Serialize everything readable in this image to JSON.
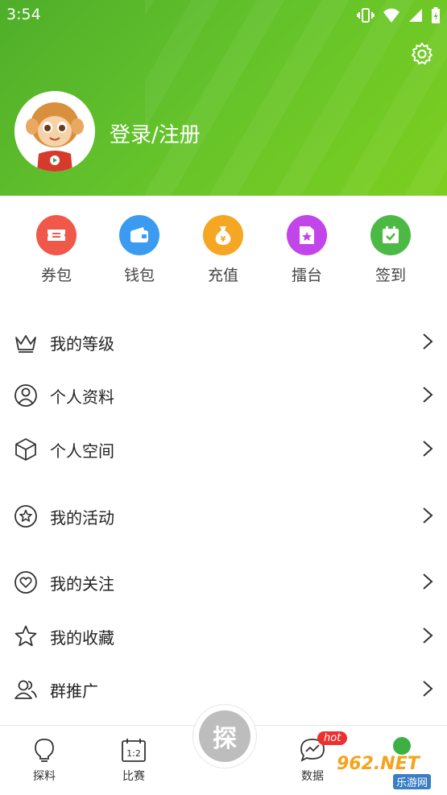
{
  "status": {
    "time": "3:54"
  },
  "profile": {
    "login_label": "登录/注册"
  },
  "quick_actions": [
    {
      "label": "券包",
      "color": "#f0584a",
      "icon": "ticket-icon"
    },
    {
      "label": "钱包",
      "color": "#3a9bf0",
      "icon": "wallet-icon"
    },
    {
      "label": "充值",
      "color": "#f5a623",
      "icon": "money-bag-icon"
    },
    {
      "label": "擂台",
      "color": "#c145e8",
      "icon": "card-star-icon"
    },
    {
      "label": "签到",
      "color": "#4cb944",
      "icon": "calendar-check-icon"
    }
  ],
  "menu": [
    {
      "label": "我的等级",
      "icon": "crown-icon"
    },
    {
      "label": "个人资料",
      "icon": "user-circle-icon"
    },
    {
      "label": "个人空间",
      "icon": "cube-icon"
    },
    {
      "label": "我的活动",
      "icon": "star-circle-icon"
    },
    {
      "label": "我的关注",
      "icon": "heart-circle-icon"
    },
    {
      "label": "我的收藏",
      "icon": "star-icon"
    },
    {
      "label": "群推广",
      "icon": "users-icon"
    }
  ],
  "tabs": {
    "tanliao": "探料",
    "bisai": "比赛",
    "center": "探",
    "shuju": "数据",
    "hot": "hot"
  },
  "watermark": {
    "top": "962.NET",
    "bottom": "乐游网"
  }
}
